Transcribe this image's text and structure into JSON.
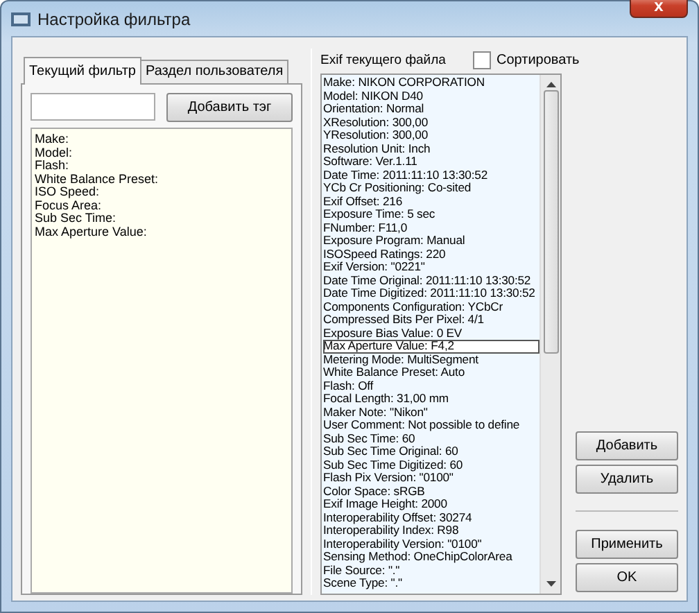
{
  "window": {
    "title": "Настройка фильтра",
    "close": "x"
  },
  "tabs": [
    {
      "label": "Текущий фильтр",
      "selected": true
    },
    {
      "label": "Раздел пользователя",
      "selected": false
    }
  ],
  "add_tag_button": "Добавить тэг",
  "filter_list": [
    "Make:",
    "Model:",
    "Flash:",
    "White Balance Preset:",
    "ISO Speed:",
    "Focus Area:",
    "Sub Sec Time:",
    "Max Aperture Value:"
  ],
  "exif_label": "Exif текущего файла",
  "sort_checkbox": {
    "label": "Сортировать",
    "checked": false
  },
  "exif_list": [
    {
      "text": "Make: NIKON CORPORATION",
      "selected": false
    },
    {
      "text": "Model: NIKON D40",
      "selected": false
    },
    {
      "text": "Orientation: Normal",
      "selected": false
    },
    {
      "text": "XResolution: 300,00",
      "selected": false
    },
    {
      "text": "YResolution: 300,00",
      "selected": false
    },
    {
      "text": "Resolution Unit: Inch",
      "selected": false
    },
    {
      "text": "Software: Ver.1.11",
      "selected": false
    },
    {
      "text": "Date Time: 2011:11:10 13:30:52",
      "selected": false
    },
    {
      "text": "YCb Cr Positioning: Co-sited",
      "selected": false
    },
    {
      "text": "Exif Offset: 216",
      "selected": false
    },
    {
      "text": "Exposure Time: 5 sec",
      "selected": false
    },
    {
      "text": "FNumber: F11,0",
      "selected": false
    },
    {
      "text": "Exposure Program: Manual",
      "selected": false
    },
    {
      "text": "ISOSpeed Ratings: 220",
      "selected": false
    },
    {
      "text": "Exif Version: \"0221\"",
      "selected": false
    },
    {
      "text": "Date Time Original: 2011:11:10 13:30:52",
      "selected": false
    },
    {
      "text": "Date Time Digitized: 2011:11:10 13:30:52",
      "selected": false
    },
    {
      "text": "Components Configuration: YCbCr",
      "selected": false
    },
    {
      "text": "Compressed Bits Per Pixel: 4/1",
      "selected": false
    },
    {
      "text": "Exposure Bias Value: 0 EV",
      "selected": false
    },
    {
      "text": "Max Aperture Value: F4,2",
      "selected": true
    },
    {
      "text": "Metering Mode: MultiSegment",
      "selected": false
    },
    {
      "text": "White Balance Preset: Auto",
      "selected": false
    },
    {
      "text": "Flash: Off",
      "selected": false
    },
    {
      "text": "Focal Length: 31,00 mm",
      "selected": false
    },
    {
      "text": "Maker Note: \"Nikon\"",
      "selected": false
    },
    {
      "text": "User Comment: Not possible to define",
      "selected": false
    },
    {
      "text": "Sub Sec Time: 60",
      "selected": false
    },
    {
      "text": "Sub Sec Time Original: 60",
      "selected": false
    },
    {
      "text": "Sub Sec Time Digitized: 60",
      "selected": false
    },
    {
      "text": "Flash Pix Version: \"0100\"",
      "selected": false
    },
    {
      "text": "Color Space: sRGB",
      "selected": false
    },
    {
      "text": "Exif Image Height: 2000",
      "selected": false
    },
    {
      "text": "Interoperability Offset: 30274",
      "selected": false
    },
    {
      "text": "Interoperability Index: R98",
      "selected": false
    },
    {
      "text": "Interoperability Version: \"0100\"",
      "selected": false
    },
    {
      "text": "Sensing Method: OneChipColorArea",
      "selected": false
    },
    {
      "text": "File Source: \".\"",
      "selected": false
    },
    {
      "text": "Scene Type: \".\"",
      "selected": false
    }
  ],
  "buttons": [
    {
      "label": "Добавить",
      "kind": "action"
    },
    {
      "label": "Удалить",
      "kind": "action"
    },
    {
      "label": "Применить",
      "kind": "dialog"
    },
    {
      "label": "OK",
      "kind": "dialog"
    }
  ]
}
